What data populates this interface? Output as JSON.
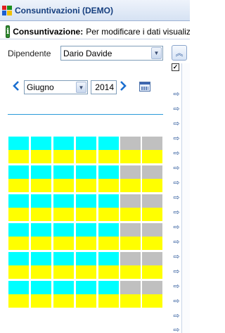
{
  "window": {
    "title": "Consuntivazioni (DEMO)",
    "logo_icon": "app-logo-icon"
  },
  "infobar": {
    "icon": "info-icon",
    "bold_label": "Consuntivazione:",
    "text": "Per modificare i dati visualizz"
  },
  "filters": {
    "dipendente_label": "Dipendente",
    "dipendente_value": "Dario Davide",
    "month_value": "Giugno",
    "year_value": "2014",
    "show_checked": true
  },
  "calendar": {
    "weeks": 6,
    "days_per_week": 7,
    "colors": {
      "workday_top": "#00ffff",
      "weekend_top": "#c0c0c0",
      "bottom": "#ffff00"
    }
  },
  "controls": {
    "collapse_icon": "double-chevron-up-icon",
    "prev_icon": "chevron-left-icon",
    "next_icon": "chevron-right-icon",
    "calendar_icon": "calendar-icon",
    "row_arrow_icon": "arrow-right-icon"
  }
}
